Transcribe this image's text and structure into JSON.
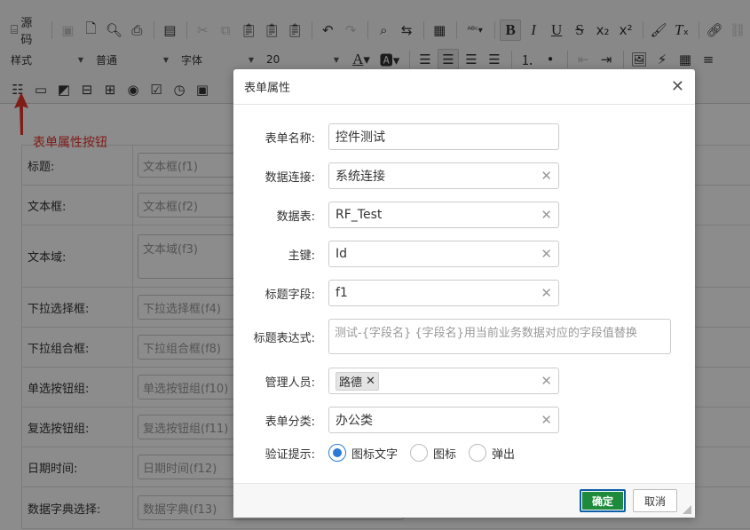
{
  "toolbar": {
    "source_label": "源码",
    "combos": {
      "style": "样式",
      "format": "普通",
      "font": "字体",
      "size": "20"
    }
  },
  "annotation": {
    "text": "表单属性按钮",
    "color": "#e8352f"
  },
  "form": {
    "rows": [
      {
        "label": "标题:",
        "placeholder": "文本框(f1)"
      },
      {
        "label": "文本框:",
        "placeholder": "文本框(f2)"
      },
      {
        "label": "文本域:",
        "placeholder": "文本域(f3)"
      },
      {
        "label": "下拉选择框:",
        "placeholder": "下拉选择框(f4)"
      },
      {
        "label": "下拉组合框:",
        "placeholder": "下拉组合框(f8)"
      },
      {
        "label": "单选按钮组:",
        "placeholder": "单选按钮组(f10)"
      },
      {
        "label": "复选按钮组:",
        "placeholder": "复选按钮组(f11)"
      },
      {
        "label": "日期时间:",
        "placeholder": "日期时间(f12)"
      },
      {
        "label": "数据字典选择:",
        "placeholder": "数据字典(f13)"
      }
    ]
  },
  "dialog": {
    "title": "表单属性",
    "fields": {
      "form_name": {
        "label": "表单名称:",
        "value": "控件测试"
      },
      "connection": {
        "label": "数据连接:",
        "value": "系统连接"
      },
      "table": {
        "label": "数据表:",
        "value": "RF_Test"
      },
      "primary_key": {
        "label": "主键:",
        "value": "Id"
      },
      "title_field": {
        "label": "标题字段:",
        "value": "f1"
      },
      "title_expr": {
        "label": "标题表达式:",
        "placeholder": "测试-{字段名} {字段名}用当前业务数据对应的字段值替换"
      },
      "managers": {
        "label": "管理人员:",
        "tag": "路德"
      },
      "category": {
        "label": "表单分类:",
        "value": "办公类"
      },
      "validation": {
        "label": "验证提示:",
        "options": [
          "图标文字",
          "图标",
          "弹出"
        ],
        "selected": "图标文字"
      }
    },
    "ok_label": "确定",
    "cancel_label": "取消"
  },
  "colors": {
    "ok_button": "#1d8b3b",
    "radio_accent": "#2b7bd6"
  }
}
